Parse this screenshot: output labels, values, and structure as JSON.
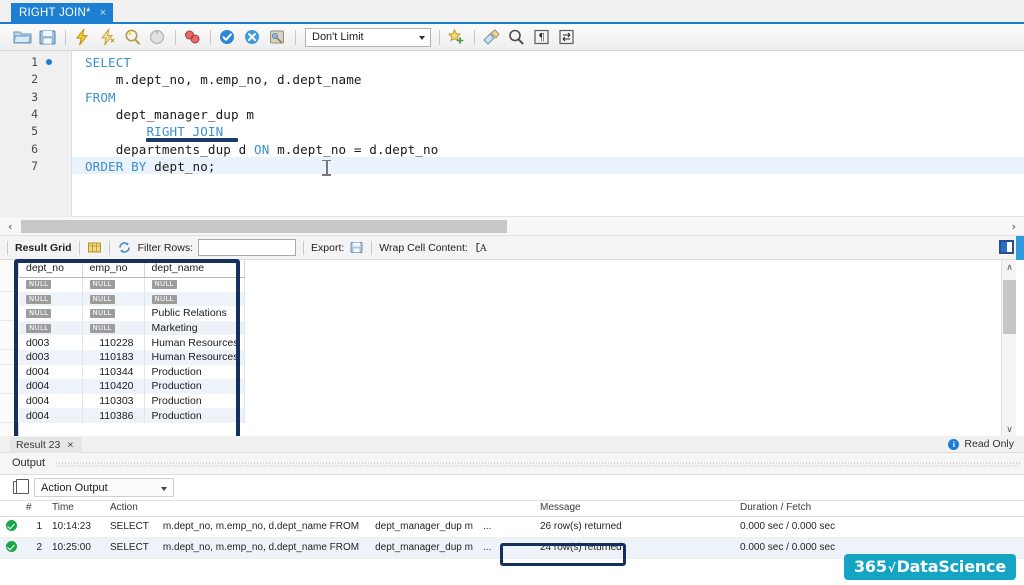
{
  "window": {
    "tab_label": "RIGHT JOIN*",
    "tab_close": "×"
  },
  "toolbar": {
    "icons": [
      {
        "name": "open-script-icon",
        "label": "Open SQL Script"
      },
      {
        "name": "save-script-icon",
        "label": "Save SQL Script"
      },
      {
        "name": "execute-icon",
        "label": "Execute"
      },
      {
        "name": "execute-current-statement-icon",
        "label": "Execute Current Statement"
      },
      {
        "name": "explain-icon",
        "label": "Explain Current Statement"
      },
      {
        "name": "stop-icon",
        "label": "Stop"
      },
      {
        "name": "toggle-explain-icon",
        "label": "Toggle Explain"
      },
      {
        "name": "commit-icon",
        "label": "Commit"
      },
      {
        "name": "rollback-icon",
        "label": "Rollback"
      },
      {
        "name": "autocommit-icon",
        "label": "Toggle Auto-Commit"
      }
    ],
    "limit_value": "Don't Limit",
    "right_icons": [
      {
        "name": "beautify-icon",
        "label": "Beautify SQL"
      },
      {
        "name": "find-icon",
        "label": "Find"
      },
      {
        "name": "invisible-chars-icon",
        "label": "Toggle Invisible Characters"
      },
      {
        "name": "wrap-lines-icon",
        "label": "Toggle Word Wrap"
      }
    ]
  },
  "editor": {
    "lines": [
      {
        "no": "1",
        "indent": 0,
        "breakpoint": true,
        "text": "SELECT",
        "tokens": [
          {
            "t": "SELECT",
            "kw": true
          }
        ]
      },
      {
        "no": "2",
        "indent": 0,
        "breakpoint": false,
        "text": "    m.dept_no, m.emp_no, d.dept_name",
        "tokens": [
          {
            "t": "    m.dept_no, m.emp_no, d.dept_name",
            "kw": false
          }
        ]
      },
      {
        "no": "3",
        "indent": 0,
        "breakpoint": false,
        "text": "FROM",
        "tokens": [
          {
            "t": "FROM",
            "kw": true
          }
        ]
      },
      {
        "no": "4",
        "indent": 0,
        "breakpoint": false,
        "text": "    dept_manager_dup m",
        "tokens": [
          {
            "t": "    dept_manager_dup m",
            "kw": false
          }
        ]
      },
      {
        "no": "5",
        "indent": 0,
        "breakpoint": false,
        "text": "        RIGHT JOIN",
        "tokens": [
          {
            "t": "        ",
            "kw": false
          },
          {
            "t": "RIGHT JOIN",
            "kw": true
          }
        ]
      },
      {
        "no": "6",
        "indent": 0,
        "breakpoint": false,
        "text": "    departments_dup d ON m.dept_no = d.dept_no",
        "tokens": [
          {
            "t": "    departments_dup d ",
            "kw": false
          },
          {
            "t": "ON",
            "kw": true
          },
          {
            "t": " m.dept_no = d.dept_no",
            "kw": false
          }
        ]
      },
      {
        "no": "7",
        "indent": 0,
        "breakpoint": false,
        "text": "ORDER BY dept_no;",
        "tokens": [
          {
            "t": "ORDER BY",
            "kw": true
          },
          {
            "t": " dept_no;",
            "kw": false
          }
        ]
      }
    ],
    "highlight_line": 7
  },
  "grid_toolbar": {
    "result_grid_label": "Result Grid",
    "grid_view_icon": "grid-view-icon",
    "refresh_icon": "refresh-icon",
    "filter_label": "Filter Rows:",
    "filter_value": "",
    "filter_placeholder": "",
    "export_label": "Export:",
    "export_icon": "export-icon",
    "wrap_label": "Wrap Cell Content:",
    "wrap_icon": "wrap-cell-icon"
  },
  "result_grid": {
    "columns": [
      "dept_no",
      "emp_no",
      "dept_name"
    ],
    "null_text": "NULL",
    "rows": [
      {
        "dept_no": "NULL",
        "emp_no": "NULL",
        "dept_name": "NULL"
      },
      {
        "dept_no": "NULL",
        "emp_no": "NULL",
        "dept_name": "NULL"
      },
      {
        "dept_no": "NULL",
        "emp_no": "NULL",
        "dept_name": "Public Relations"
      },
      {
        "dept_no": "NULL",
        "emp_no": "NULL",
        "dept_name": "Marketing"
      },
      {
        "dept_no": "d003",
        "emp_no": "110228",
        "dept_name": "Human Resources"
      },
      {
        "dept_no": "d003",
        "emp_no": "110183",
        "dept_name": "Human Resources"
      },
      {
        "dept_no": "d004",
        "emp_no": "110344",
        "dept_name": "Production"
      },
      {
        "dept_no": "d004",
        "emp_no": "110420",
        "dept_name": "Production"
      },
      {
        "dept_no": "d004",
        "emp_no": "110303",
        "dept_name": "Production"
      },
      {
        "dept_no": "d004",
        "emp_no": "110386",
        "dept_name": "Production"
      }
    ],
    "scroll_up": "∧",
    "scroll_down": "∨"
  },
  "result_tabs": {
    "active_tab": "Result 23",
    "close": "×",
    "read_only": "Read Only",
    "info_glyph": "i"
  },
  "output": {
    "panel_title": "Output",
    "selector_value": "Action Output",
    "columns": [
      "#",
      "Time",
      "Action",
      "Message",
      "Duration / Fetch"
    ],
    "rows": [
      {
        "status": "success",
        "num": "1",
        "time": "10:14:23",
        "action_kw": "SELECT",
        "action_sql": "m.dept_no, m.emp_no, d.dept_name FROM",
        "action_tbl": "dept_manager_dup m",
        "action_ellipsis": "...",
        "message": "26 row(s) returned",
        "duration": "0.000 sec / 0.000 sec",
        "highlighted": false
      },
      {
        "status": "success",
        "num": "2",
        "time": "10:25:00",
        "action_kw": "SELECT",
        "action_sql": "m.dept_no, m.emp_no, d.dept_name FROM",
        "action_tbl": "dept_manager_dup m",
        "action_ellipsis": "...",
        "message": "24 row(s) returned",
        "duration": "0.000 sec / 0.000 sec",
        "highlighted": true
      }
    ]
  },
  "horizontal_scroll": {
    "left_arrow": "‹",
    "right_arrow": "›"
  },
  "watermark": {
    "prefix": "365",
    "radical": "√",
    "suffix": "DataScience"
  },
  "colors": {
    "accent_blue": "#1d7fd2",
    "keyword_blue": "#3a8fd0",
    "annotation_navy": "#16305e",
    "success_green": "#19a64a",
    "watermark_teal": "#14a5c4",
    "null_chip_gray": "#9c9c9c"
  }
}
